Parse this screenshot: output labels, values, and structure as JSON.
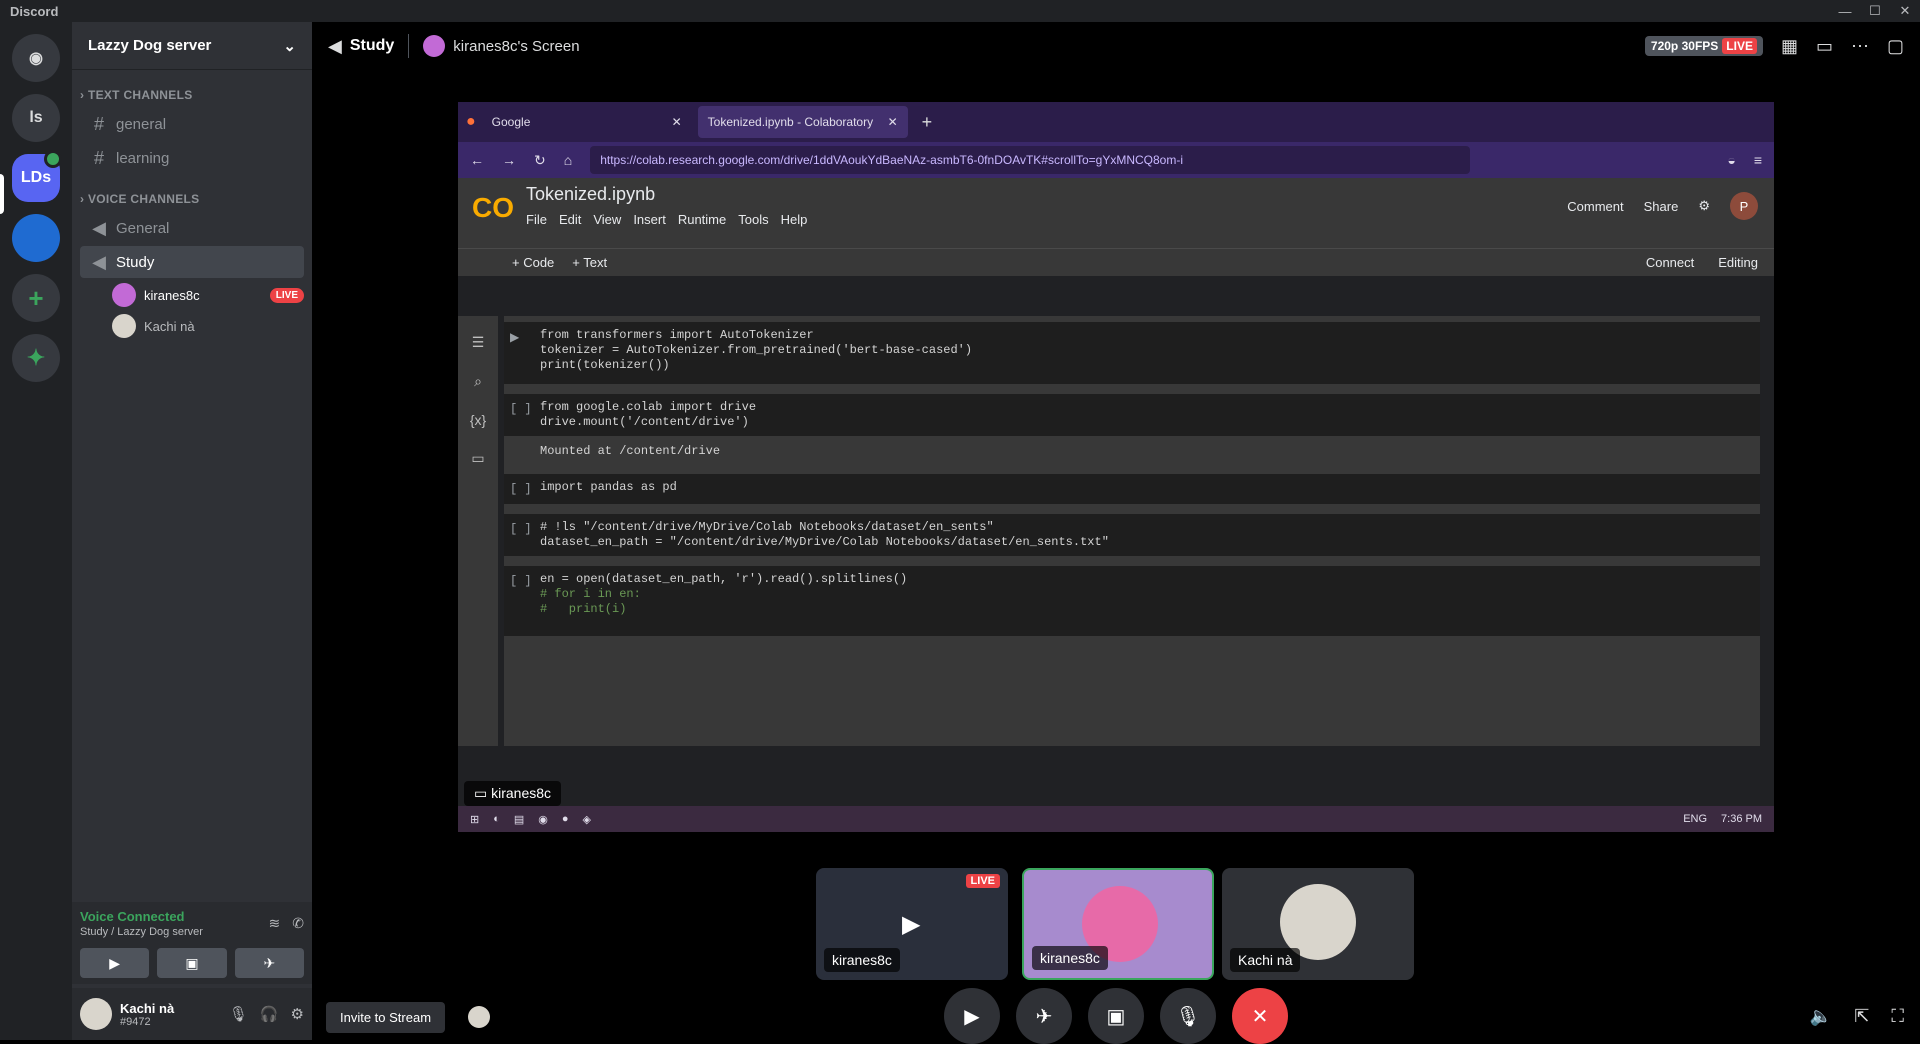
{
  "app": {
    "title": "Discord"
  },
  "rail": {
    "servers": [
      {
        "label": "ls",
        "icon": ""
      },
      {
        "label": "LDs",
        "icon": ""
      }
    ]
  },
  "sidebar": {
    "server_name": "Lazzy Dog server",
    "text_header": "TEXT CHANNELS",
    "text_channels": [
      "general",
      "learning"
    ],
    "voice_header": "VOICE CHANNELS",
    "voice_channels": [
      "General",
      "Study"
    ],
    "members": [
      {
        "name": "kiranes8c",
        "badge": "LIVE"
      },
      {
        "name": "Kachi nà",
        "badge": ""
      }
    ]
  },
  "voice": {
    "status": "Voice Connected",
    "location": "Study / Lazzy Dog server"
  },
  "user": {
    "name": "Kachi nà",
    "tag": "#9472"
  },
  "header": {
    "channel": "Study",
    "stream_owner": "kiranes8c's Screen",
    "quality": "720p 30FPS",
    "live": "LIVE"
  },
  "stream": {
    "tabs": [
      {
        "title": "Google"
      },
      {
        "title": "Tokenized.ipynb - Colaboratory"
      }
    ],
    "url": "https://colab.research.google.com/drive/1ddVAoukYdBaeNAz-asmbT6-0fnDOAvTK#scrollTo=gYxMNCQ8om-i",
    "notebook_title": "Tokenized.ipynb",
    "menu": [
      "File",
      "Edit",
      "View",
      "Insert",
      "Runtime",
      "Tools",
      "Help"
    ],
    "actions": {
      "comment": "Comment",
      "share": "Share",
      "avatar": "P"
    },
    "toolbar": {
      "code": "+ Code",
      "text": "+ Text",
      "connect": "Connect",
      "editing": "Editing"
    },
    "cells": [
      {
        "bracket": "",
        "lines": [
          "from transformers import AutoTokenizer",
          "tokenizer = AutoTokenizer.from_pretrained('bert-base-cased')",
          "print(tokenizer())"
        ]
      },
      {
        "bracket": "[ ]",
        "lines": [
          "from google.colab import drive",
          "drive.mount('/content/drive')"
        ],
        "output": "Mounted at /content/drive"
      },
      {
        "bracket": "[ ]",
        "lines": [
          "import pandas as pd"
        ]
      },
      {
        "bracket": "[ ]",
        "lines": [
          "# !ls \"/content/drive/MyDrive/Colab Notebooks/dataset/en_sents\"",
          "dataset_en_path = \"/content/drive/MyDrive/Colab Notebooks/dataset/en_sents.txt\""
        ]
      },
      {
        "bracket": "[ ]",
        "lines": [
          "en = open(dataset_en_path, 'r').read().splitlines()",
          "# for i in en:",
          "#   print(i)"
        ]
      }
    ],
    "taskbar": {
      "lang": "ENG",
      "time": "7:36 PM"
    },
    "label": "kiranes8c"
  },
  "tiles": [
    {
      "label": "kiranes8c",
      "badge": "LIVE"
    },
    {
      "label": "kiranes8c",
      "badge": ""
    },
    {
      "label": "Kachi nà",
      "badge": ""
    }
  ],
  "controls": {
    "invite": "Invite to Stream"
  }
}
